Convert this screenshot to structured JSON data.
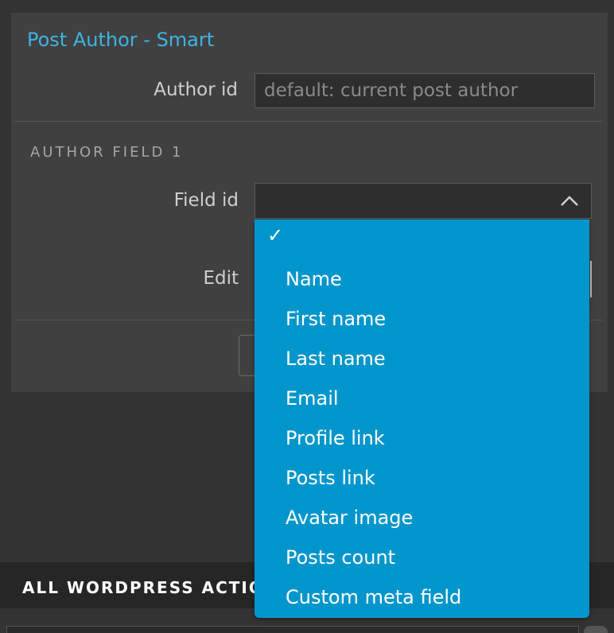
{
  "widget": {
    "title": "Post Author - Smart",
    "author_id_label": "Author id",
    "author_id_placeholder": "default: current post author",
    "section_title": "AUTHOR FIELD 1",
    "field_id_label": "Field id",
    "edit_label": "Edit"
  },
  "dropdown": {
    "selected_mark": "✓",
    "options": [
      "Name",
      "First name",
      "Last name",
      "Email",
      "Profile link",
      "Posts link",
      "Avatar image",
      "Posts count",
      "Custom meta field"
    ]
  },
  "footer": {
    "section_title": "ALL WORDPRESS ACTIONS"
  },
  "colors": {
    "accent": "#3eb3e5",
    "dropdown_bg": "#0096cc",
    "panel_bg": "#404040",
    "page_bg": "#333333"
  }
}
